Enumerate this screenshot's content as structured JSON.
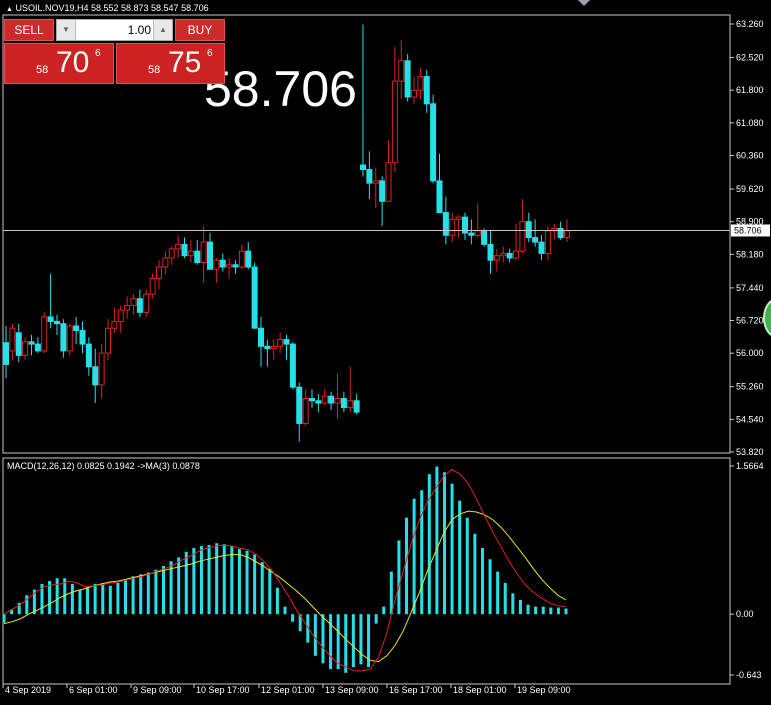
{
  "header": {
    "symbol_info": "USOIL.NOV19,H4  58.552 58.873 58.547 58.706"
  },
  "trade_panel": {
    "sell_label": "SELL",
    "buy_label": "BUY",
    "lot_value": "1.00",
    "sell_price_prefix": "58",
    "sell_price_main": "70",
    "sell_price_sup": "6",
    "buy_price_prefix": "58",
    "buy_price_main": "75",
    "buy_price_sup": "6"
  },
  "big_price": "58.706",
  "macd_label": "MACD(12,26,12) 0.0825 0.1942  ->MA(3) 0.0878",
  "current_price_tag": "58.706",
  "colors": {
    "bull": "#26e0e8",
    "bear": "#e02020",
    "signal": "#e8e820",
    "macd_line": "#e02020",
    "grid": "#c8c8c8"
  },
  "chart_data": [
    {
      "type": "candlestick",
      "title": "USOIL.NOV19,H4",
      "y_ticks": [
        "63.260",
        "62.520",
        "61.800",
        "61.080",
        "60.360",
        "59.620",
        "58.900",
        "58.180",
        "57.440",
        "56.720",
        "56.000",
        "55.260",
        "54.540",
        "53.820"
      ],
      "ylim": [
        53.82,
        63.26
      ],
      "x_ticks": [
        "4 Sep 2019",
        "6 Sep 01:00",
        "9 Sep 09:00",
        "10 Sep 17:00",
        "12 Sep 01:00",
        "13 Sep 09:00",
        "16 Sep 17:00",
        "18 Sep 01:00",
        "19 Sep 09:00"
      ],
      "current_price": 58.706,
      "candles": [
        [
          56.23,
          56.6,
          55.45,
          55.75
        ],
        [
          56.05,
          56.65,
          55.85,
          56.55
        ],
        [
          56.45,
          56.65,
          55.8,
          55.95
        ],
        [
          55.95,
          56.35,
          55.85,
          56.25
        ],
        [
          56.25,
          56.4,
          55.95,
          56.2
        ],
        [
          56.2,
          56.35,
          56.0,
          56.05
        ],
        [
          56.05,
          56.9,
          56.0,
          56.8
        ],
        [
          56.8,
          57.75,
          56.55,
          56.7
        ],
        [
          56.7,
          56.85,
          56.4,
          56.65
        ],
        [
          56.65,
          56.75,
          55.9,
          56.05
        ],
        [
          56.05,
          56.65,
          55.95,
          56.6
        ],
        [
          56.6,
          56.8,
          56.2,
          56.5
        ],
        [
          56.5,
          56.7,
          56.0,
          56.2
        ],
        [
          56.2,
          56.35,
          55.5,
          55.7
        ],
        [
          55.7,
          56.1,
          54.9,
          55.3
        ],
        [
          55.3,
          56.2,
          55.0,
          56.0
        ],
        [
          56.0,
          56.75,
          55.85,
          56.55
        ],
        [
          56.55,
          57.0,
          56.45,
          56.7
        ],
        [
          56.7,
          57.05,
          56.45,
          56.95
        ],
        [
          56.95,
          57.25,
          56.75,
          57.05
        ],
        [
          57.05,
          57.3,
          56.85,
          57.2
        ],
        [
          57.2,
          57.4,
          56.8,
          56.9
        ],
        [
          56.9,
          57.4,
          56.8,
          57.3
        ],
        [
          57.3,
          57.75,
          57.2,
          57.65
        ],
        [
          57.65,
          58.05,
          57.4,
          57.9
        ],
        [
          57.9,
          58.25,
          57.75,
          58.1
        ],
        [
          58.1,
          58.35,
          57.95,
          58.3
        ],
        [
          58.3,
          58.6,
          58.1,
          58.4
        ],
        [
          58.4,
          58.55,
          58.1,
          58.15
        ],
        [
          58.15,
          58.5,
          58.0,
          58.25
        ],
        [
          58.25,
          58.5,
          57.95,
          58.0
        ],
        [
          58.0,
          58.8,
          57.55,
          58.45
        ],
        [
          58.45,
          58.65,
          57.85,
          57.85
        ],
        [
          57.85,
          58.1,
          57.55,
          58.05
        ],
        [
          58.05,
          58.2,
          57.8,
          57.9
        ],
        [
          57.9,
          58.1,
          57.65,
          57.95
        ],
        [
          57.95,
          58.05,
          57.75,
          57.9
        ],
        [
          57.9,
          58.4,
          57.85,
          58.25
        ],
        [
          58.25,
          58.45,
          57.85,
          57.9
        ],
        [
          57.9,
          58.0,
          56.6,
          56.55
        ],
        [
          56.55,
          56.8,
          55.7,
          56.15
        ],
        [
          56.15,
          56.3,
          55.7,
          56.1
        ],
        [
          56.1,
          56.3,
          55.85,
          56.15
        ],
        [
          56.15,
          56.45,
          56.0,
          56.3
        ],
        [
          56.3,
          56.4,
          55.85,
          56.2
        ],
        [
          56.2,
          56.25,
          55.2,
          55.25
        ],
        [
          55.25,
          55.35,
          54.05,
          54.45
        ],
        [
          54.45,
          55.2,
          54.4,
          55.0
        ],
        [
          55.0,
          55.2,
          54.8,
          54.95
        ],
        [
          54.95,
          55.1,
          54.7,
          54.9
        ],
        [
          54.9,
          55.2,
          54.85,
          55.05
        ],
        [
          55.05,
          55.15,
          54.75,
          54.9
        ],
        [
          54.9,
          55.55,
          54.55,
          55.0
        ],
        [
          55.0,
          55.15,
          54.7,
          54.8
        ],
        [
          54.8,
          55.7,
          54.7,
          54.95
        ],
        [
          54.95,
          55.1,
          54.65,
          54.7
        ],
        [
          60.15,
          63.25,
          59.9,
          60.05
        ],
        [
          60.05,
          60.45,
          59.4,
          59.75
        ],
        [
          59.75,
          60.1,
          59.2,
          59.8
        ],
        [
          59.8,
          59.9,
          58.8,
          59.35
        ],
        [
          59.35,
          60.7,
          59.35,
          60.2
        ],
        [
          60.2,
          62.75,
          60.0,
          62.0
        ],
        [
          62.0,
          62.9,
          61.6,
          62.45
        ],
        [
          62.45,
          62.6,
          61.55,
          61.65
        ],
        [
          61.65,
          62.1,
          61.5,
          61.8
        ],
        [
          61.8,
          62.3,
          61.6,
          62.1
        ],
        [
          62.1,
          62.25,
          61.3,
          61.5
        ],
        [
          61.5,
          61.7,
          59.75,
          59.8
        ],
        [
          59.8,
          60.4,
          59.5,
          59.1
        ],
        [
          59.1,
          59.45,
          58.4,
          58.6
        ],
        [
          58.6,
          59.1,
          58.45,
          58.95
        ],
        [
          58.95,
          59.05,
          58.55,
          59.0
        ],
        [
          59.0,
          59.1,
          58.5,
          58.65
        ],
        [
          58.65,
          58.95,
          58.4,
          58.6
        ],
        [
          58.6,
          59.3,
          58.55,
          58.7
        ],
        [
          58.7,
          58.75,
          58.35,
          58.4
        ],
        [
          58.4,
          58.7,
          57.75,
          58.05
        ],
        [
          58.05,
          58.3,
          57.8,
          58.15
        ],
        [
          58.15,
          58.35,
          58.0,
          58.2
        ],
        [
          58.2,
          58.3,
          58.0,
          58.1
        ],
        [
          58.1,
          58.85,
          58.05,
          58.25
        ],
        [
          58.25,
          59.4,
          58.2,
          58.9
        ],
        [
          58.9,
          59.1,
          58.45,
          58.55
        ],
        [
          58.55,
          58.95,
          58.35,
          58.45
        ],
        [
          58.45,
          58.6,
          58.05,
          58.2
        ],
        [
          58.2,
          58.8,
          58.05,
          58.7
        ],
        [
          58.7,
          58.85,
          58.5,
          58.75
        ],
        [
          58.75,
          58.9,
          58.5,
          58.55
        ],
        [
          58.55,
          58.95,
          58.45,
          58.7
        ]
      ]
    },
    {
      "type": "bar",
      "title": "MACD(12,26,12) 0.0825 0.1942 ->MA(3) 0.0878",
      "y_ticks": [
        "1.5664",
        "0.00",
        "-0.643"
      ],
      "ylim": [
        -0.643,
        1.5664
      ],
      "series": [
        {
          "name": "MACD",
          "type": "bar",
          "values": [
            -0.09,
            0.05,
            0.12,
            0.2,
            0.26,
            0.32,
            0.35,
            0.38,
            0.38,
            0.32,
            0.26,
            0.29,
            0.32,
            0.33,
            0.3,
            0.33,
            0.36,
            0.4,
            0.42,
            0.44,
            0.47,
            0.51,
            0.56,
            0.6,
            0.66,
            0.7,
            0.72,
            0.73,
            0.75,
            0.74,
            0.72,
            0.69,
            0.67,
            0.63,
            0.55,
            0.48,
            0.28,
            0.08,
            -0.08,
            -0.18,
            -0.3,
            -0.44,
            -0.52,
            -0.58,
            -0.58,
            -0.62,
            -0.56,
            -0.53,
            -0.56,
            -0.1,
            0.08,
            0.45,
            0.78,
            1.02,
            1.22,
            1.31,
            1.48,
            1.56,
            1.5,
            1.38,
            1.2,
            1.02,
            0.85,
            0.7,
            0.58,
            0.45,
            0.33,
            0.22,
            0.15,
            0.1,
            0.08,
            0.08,
            0.07,
            0.07,
            0.06
          ]
        },
        {
          "name": "Signal",
          "type": "line",
          "values": [
            -0.1,
            -0.08,
            -0.05,
            0.0,
            0.04,
            0.08,
            0.13,
            0.18,
            0.22,
            0.25,
            0.27,
            0.3,
            0.32,
            0.34,
            0.35,
            0.37,
            0.39,
            0.41,
            0.43,
            0.45,
            0.47,
            0.49,
            0.51,
            0.53,
            0.56,
            0.58,
            0.6,
            0.62,
            0.63,
            0.63,
            0.6,
            0.55,
            0.5,
            0.44,
            0.38,
            0.31,
            0.24,
            0.16,
            0.07,
            -0.02,
            -0.1,
            -0.18,
            -0.27,
            -0.35,
            -0.43,
            -0.49,
            -0.5,
            -0.44,
            -0.33,
            -0.18,
            0.02,
            0.23,
            0.46,
            0.66,
            0.86,
            1.0,
            1.06,
            1.09,
            1.08,
            1.05,
            1.0,
            0.92,
            0.82,
            0.71,
            0.6,
            0.48,
            0.37,
            0.28,
            0.2,
            0.15
          ]
        },
        {
          "name": "MA",
          "type": "line",
          "values": [
            0.0,
            0.05,
            0.1,
            0.17,
            0.24,
            0.29,
            0.31,
            0.32,
            0.35,
            0.33,
            0.29,
            0.3,
            0.31,
            0.33,
            0.34,
            0.36,
            0.38,
            0.4,
            0.43,
            0.46,
            0.49,
            0.53,
            0.58,
            0.62,
            0.67,
            0.7,
            0.72,
            0.73,
            0.72,
            0.7,
            0.68,
            0.63,
            0.55,
            0.45,
            0.32,
            0.18,
            0.03,
            -0.1,
            -0.23,
            -0.34,
            -0.44,
            -0.52,
            -0.56,
            -0.6,
            -0.6,
            -0.58,
            -0.45,
            -0.2,
            0.15,
            0.45,
            0.75,
            1.0,
            1.19,
            1.33,
            1.46,
            1.53,
            1.48,
            1.38,
            1.22,
            1.04,
            0.87,
            0.72,
            0.56,
            0.43,
            0.31,
            0.23,
            0.17,
            0.12,
            0.09,
            0.08
          ]
        }
      ]
    }
  ]
}
